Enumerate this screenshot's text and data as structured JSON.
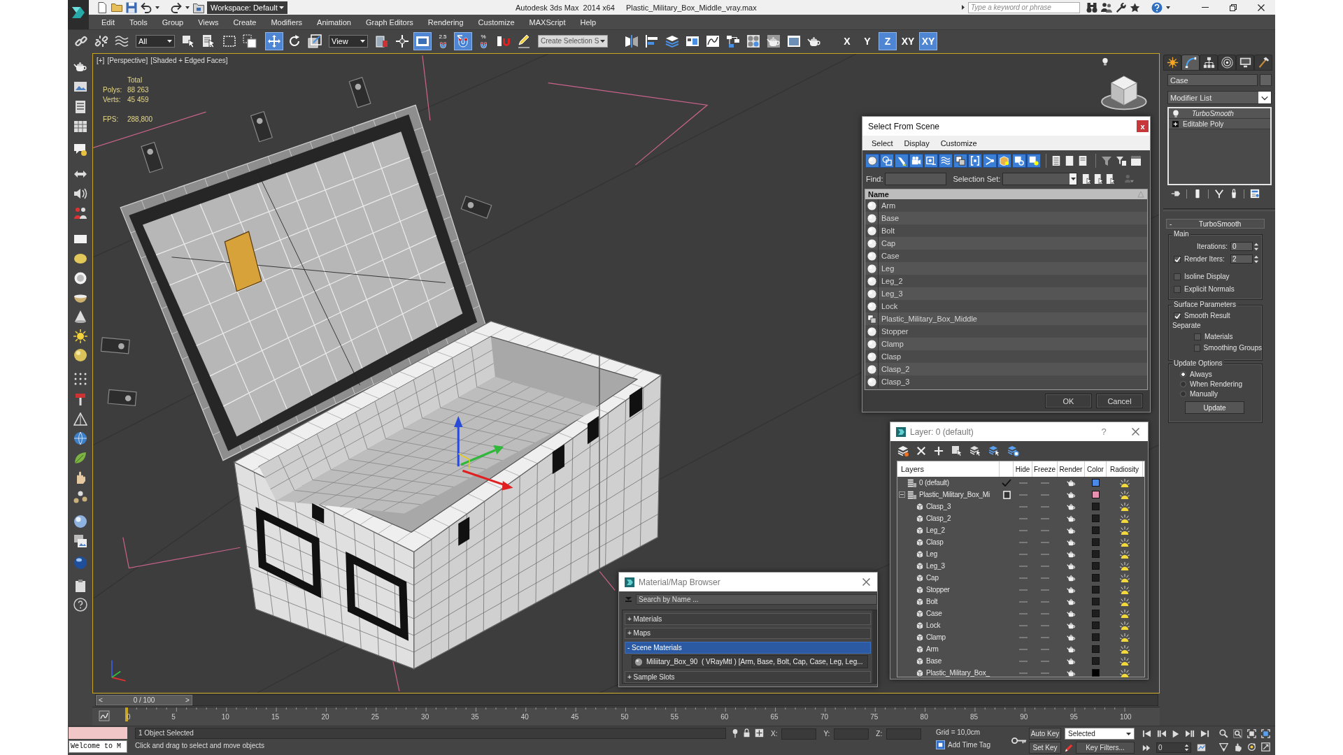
{
  "title_bar": {
    "workspace": "Workspace: Default",
    "app_title": "Autodesk 3ds Max  2014 x64",
    "file_name": "Plastic_Military_Box_Middle_vray.max",
    "search": {
      "placeholder": "Type a keyword or phrase"
    }
  },
  "menu_bar": [
    "Edit",
    "Tools",
    "Group",
    "Views",
    "Create",
    "Modifiers",
    "Animation",
    "Graph Editors",
    "Rendering",
    "Customize",
    "MAXScript",
    "Help"
  ],
  "main_toolbar": {
    "items": [
      {
        "kind": "link",
        "selected": false
      },
      {
        "kind": "unlink",
        "selected": false
      },
      {
        "kind": "bind",
        "selected": false
      },
      {
        "kind": "dropdown",
        "value": "All"
      },
      {
        "kind": "select",
        "selected": false
      },
      {
        "kind": "select-by-name",
        "selected": false
      },
      {
        "kind": "region",
        "selected": false
      },
      {
        "kind": "crossing",
        "selected": false
      },
      {
        "kind": "move",
        "selected": true
      },
      {
        "kind": "rotate",
        "selected": false
      },
      {
        "kind": "scale",
        "selected": false
      },
      {
        "kind": "dropdown",
        "value": "View"
      },
      {
        "kind": "pivot",
        "selected": false
      },
      {
        "kind": "manipulate",
        "selected": false
      },
      {
        "kind": "override",
        "selected": true
      },
      {
        "kind": "snap",
        "label": "2.5",
        "selected": false
      },
      {
        "kind": "angle-snap",
        "selected": true
      },
      {
        "kind": "snap",
        "label": "%",
        "selected": false
      },
      {
        "kind": "spinner-snap",
        "selected": false
      },
      {
        "kind": "named-sets",
        "selected": false
      },
      {
        "kind": "selection-set",
        "value": "Create Selection S"
      },
      {
        "kind": "mirror",
        "selected": false
      },
      {
        "kind": "align",
        "selected": false
      },
      {
        "kind": "layers",
        "selected": false
      },
      {
        "kind": "ribbon",
        "selected": false
      },
      {
        "kind": "curve-editor",
        "selected": false
      },
      {
        "kind": "schematic",
        "selected": false
      },
      {
        "kind": "material-editor",
        "selected": false
      },
      {
        "kind": "render-setup",
        "selected": false
      },
      {
        "kind": "frame-window",
        "selected": false
      },
      {
        "kind": "render",
        "selected": false
      },
      {
        "kind": "axis",
        "label": "X",
        "selected": false
      },
      {
        "kind": "axis",
        "label": "Y",
        "selected": false
      },
      {
        "kind": "axis",
        "label": "Z",
        "selected": true
      },
      {
        "kind": "axis",
        "label": "XY",
        "selected": false
      },
      {
        "kind": "axis",
        "label": "XY",
        "selected": true
      }
    ]
  },
  "viewport": {
    "labels": [
      "[+]",
      "[Perspective]",
      "[Shaded + Edged Faces]"
    ],
    "stats": {
      "heading": "Total",
      "rows": [
        {
          "label": "Polys:",
          "value": "88 263"
        },
        {
          "label": "Verts:",
          "value": "45 459"
        }
      ],
      "fps": {
        "label": "FPS:",
        "value": "288,800"
      }
    }
  },
  "select_from_scene": {
    "title": "Select From Scene",
    "close": "x",
    "menus": [
      "Select",
      "Display",
      "Customize"
    ],
    "filters": [
      {
        "kind": "geometry",
        "on": true
      },
      {
        "kind": "shape",
        "on": true
      },
      {
        "kind": "light",
        "on": true
      },
      {
        "kind": "camera",
        "on": true
      },
      {
        "kind": "helper",
        "on": true
      },
      {
        "kind": "spacewarp",
        "on": true
      },
      {
        "kind": "group",
        "on": true
      },
      {
        "kind": "xref",
        "on": true
      },
      {
        "kind": "bone",
        "on": true
      },
      {
        "kind": "container",
        "on": true
      },
      {
        "kind": "frozen",
        "on": true
      },
      {
        "kind": "hidden",
        "on": true
      }
    ],
    "find": {
      "label": "Find:"
    },
    "selection_set": {
      "label": "Selection Set:"
    },
    "column": "Name",
    "objects": [
      {
        "name": "Arm",
        "kind": "geometry"
      },
      {
        "name": "Base",
        "kind": "geometry"
      },
      {
        "name": "Bolt",
        "kind": "geometry"
      },
      {
        "name": "Cap",
        "kind": "geometry"
      },
      {
        "name": "Case",
        "kind": "geometry"
      },
      {
        "name": "Leg",
        "kind": "geometry"
      },
      {
        "name": "Leg_2",
        "kind": "geometry"
      },
      {
        "name": "Leg_3",
        "kind": "geometry"
      },
      {
        "name": "Lock",
        "kind": "geometry"
      },
      {
        "name": "Plastic_Military_Box_Middle",
        "kind": "group"
      },
      {
        "name": "Stopper",
        "kind": "geometry"
      },
      {
        "name": "Clamp",
        "kind": "geometry"
      },
      {
        "name": "Clasp",
        "kind": "geometry"
      },
      {
        "name": "Clasp_2",
        "kind": "geometry"
      },
      {
        "name": "Clasp_3",
        "kind": "geometry"
      }
    ],
    "buttons": [
      "OK",
      "Cancel"
    ]
  },
  "layer_manager": {
    "title": "Layer: 0 (default)",
    "help": "?",
    "columns": [
      "Layers",
      "Hide",
      "Freeze",
      "Render",
      "Color",
      "Radiosity"
    ],
    "layers": [
      {
        "name": "0 (default)",
        "current": true,
        "color": "#4a8ae6"
      },
      {
        "name": "Plastic_Military_Box_Mi",
        "current": false,
        "color": "#e890b0",
        "expanded": true,
        "children": [
          {
            "name": "Clasp_3",
            "color": "#1e1e1e"
          },
          {
            "name": "Clasp_2",
            "color": "#1e1e1e"
          },
          {
            "name": "Leg_2",
            "color": "#1e1e1e"
          },
          {
            "name": "Clasp",
            "color": "#1e1e1e"
          },
          {
            "name": "Leg",
            "color": "#1e1e1e"
          },
          {
            "name": "Leg_3",
            "color": "#1e1e1e"
          },
          {
            "name": "Cap",
            "color": "#1e1e1e"
          },
          {
            "name": "Stopper",
            "color": "#1e1e1e"
          },
          {
            "name": "Bolt",
            "color": "#1e1e1e"
          },
          {
            "name": "Case",
            "color": "#1e1e1e"
          },
          {
            "name": "Lock",
            "color": "#1e1e1e"
          },
          {
            "name": "Clamp",
            "color": "#1e1e1e"
          },
          {
            "name": "Arm",
            "color": "#1e1e1e"
          },
          {
            "name": "Base",
            "color": "#1e1e1e"
          },
          {
            "name": "Plastic_Military_Box_",
            "color": "#000000"
          }
        ]
      }
    ]
  },
  "material_browser": {
    "title": "Material/Map Browser",
    "search": {
      "placeholder": "Search by Name ..."
    },
    "groups": [
      {
        "toggle": "+",
        "label": "Materials",
        "selected": false
      },
      {
        "toggle": "+",
        "label": "Maps",
        "selected": false
      },
      {
        "toggle": "-",
        "label": "Scene Materials",
        "selected": true,
        "items": [
          "Miliitary_Box_90  ( VRayMtl ) [Arm, Base, Bolt, Cap, Case, Leg, Leg..."
        ]
      },
      {
        "toggle": "+",
        "label": "Sample Slots",
        "selected": false
      }
    ]
  },
  "command_panel": {
    "tabs": [
      {
        "kind": "create",
        "selected": false
      },
      {
        "kind": "modify",
        "selected": true
      },
      {
        "kind": "hierarchy",
        "selected": false
      },
      {
        "kind": "motion",
        "selected": false
      },
      {
        "kind": "display",
        "selected": false
      },
      {
        "kind": "utilities",
        "selected": false
      }
    ],
    "object_name": "Case",
    "modifier_list": "Modifier List",
    "stack": [
      {
        "name": "TurboSmooth",
        "kind": "modifier"
      },
      {
        "name": "Editable Poly",
        "kind": "base"
      }
    ],
    "rollout": {
      "toggle": "-",
      "title": "TurboSmooth",
      "main": {
        "title": "Main",
        "iterations": {
          "label": "Iterations:",
          "value": "0"
        },
        "render_iters": {
          "label": "Render Iters:",
          "value": "2",
          "checked": true
        },
        "options": [
          {
            "label": "Isoline Display",
            "checked": false
          },
          {
            "label": "Explicit Normals",
            "checked": false
          }
        ]
      },
      "surface": {
        "title": "Surface Parameters",
        "smooth_result": {
          "label": "Smooth Result",
          "checked": true
        },
        "separate": "Separate",
        "options": [
          {
            "label": "Materials",
            "checked": false
          },
          {
            "label": "Smoothing Groups",
            "checked": false
          }
        ]
      },
      "update": {
        "title": "Update Options",
        "options": [
          {
            "label": "Always",
            "selected": true
          },
          {
            "label": "When Rendering",
            "selected": false
          },
          {
            "label": "Manually",
            "selected": false
          }
        ],
        "button": "Update"
      }
    }
  },
  "timeline": {
    "prev": "<",
    "position": "0 / 100",
    "next": ">",
    "level": 0,
    "ticks": [
      "0",
      "5",
      "10",
      "15",
      "20",
      "25",
      "30",
      "35",
      "40",
      "45",
      "50",
      "55",
      "60",
      "65",
      "70",
      "75",
      "80",
      "85",
      "90",
      "95",
      "100"
    ]
  },
  "status_bar": {
    "listener_output": "Welcome to M",
    "selection": "1 Object Selected",
    "prompt": "Click and drag to select and move objects",
    "coordinate_labels": [
      "X:",
      "Y:",
      "Z:"
    ],
    "grid": "Grid = 10,0cm",
    "time_tag": "Add Time Tag",
    "auto_key": "Auto Key",
    "key_mode": "Selected",
    "set_key": "Set Key",
    "key_filters": "Key Filters...",
    "frame": "0"
  }
}
